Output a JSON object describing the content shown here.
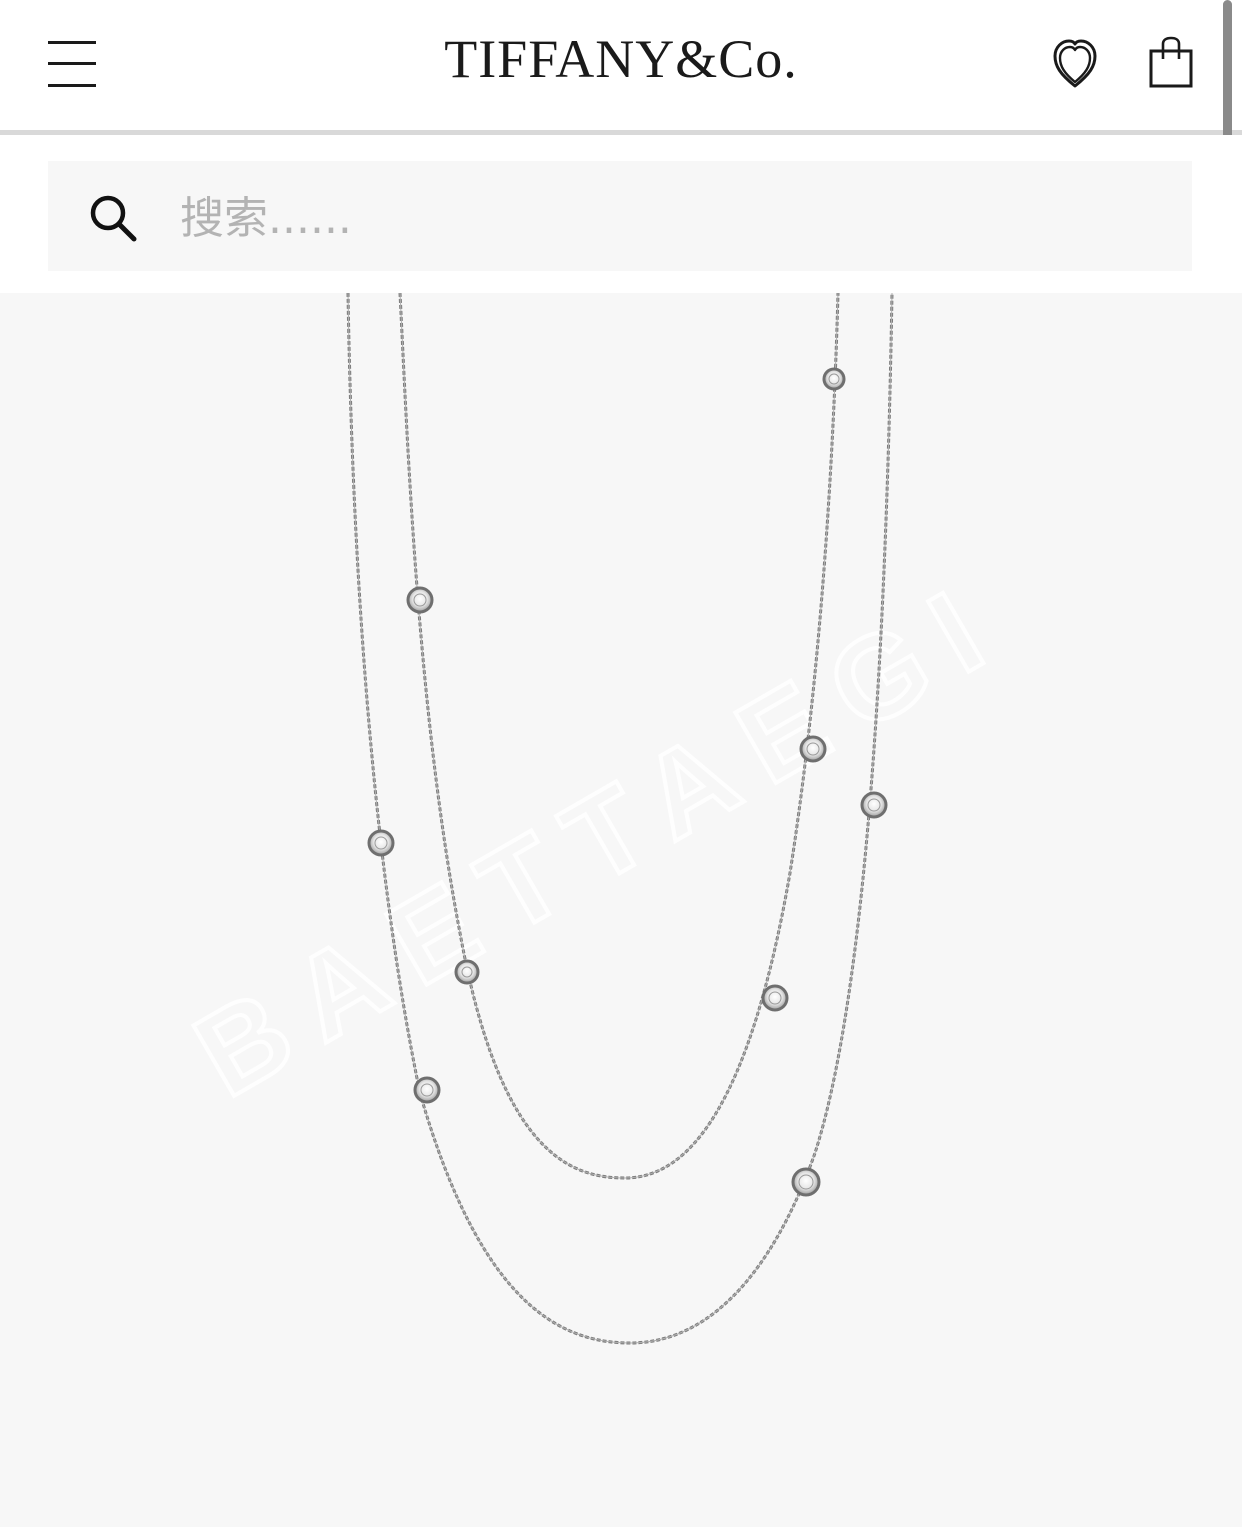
{
  "header": {
    "logo_text": "TIFFANY&Co.",
    "menu_icon": "hamburger-menu-icon",
    "wishlist_icon": "heart-icon",
    "bag_icon": "shopping-bag-icon"
  },
  "search": {
    "icon": "search-icon",
    "placeholder": "搜索......",
    "value": ""
  },
  "product": {
    "image_description_icon": "diamond-station-necklace-image",
    "watermark": "BAETTAEGI"
  },
  "colors": {
    "background": "#ffffff",
    "search_bg": "#f7f7f7",
    "image_bg": "#f7f7f7",
    "text_dark": "#1a1a1a",
    "placeholder": "#b3b3b3"
  }
}
